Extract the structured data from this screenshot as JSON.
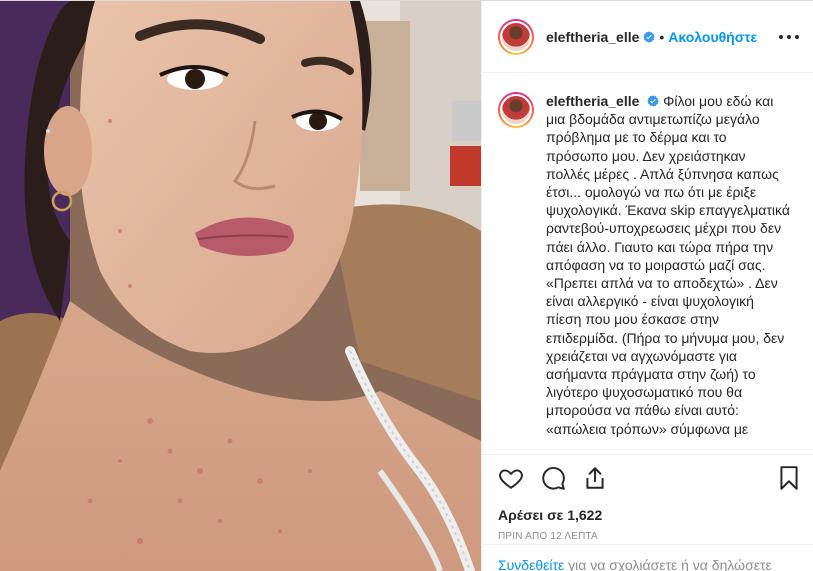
{
  "header": {
    "username": "eleftheria_elle",
    "separator": "•",
    "follow_label": "Ακολουθήστε"
  },
  "caption": {
    "username": "eleftheria_elle",
    "text": "Φίλοι μου εδώ και μια βδομάδα αντιμετωπίζω μεγάλο πρόβλημα με το δέρμα και το πρόσωπο μου. Δεν χρειάστηκαν πολλές μέρες . Απλά ξύπνησα καπως έτσι... ομολογώ να πω ότι με έριξε ψυχολογικά. Έκανα skip επαγγελματικά ραντεβού-υποχρεωσεις μέχρι που δεν πάει άλλο. Γιαυτο και τώρα πήρα την απόφαση να το μοιραστώ μαζί σας. «Πρεπει απλά να το αποδεχτώ» . Δεν είναι αλλεργικό - είναι ψυχολογική πίεση που μου έσκασε στην επιδερμίδα. (Πήρα το μήνυμα μου, δεν χρειάζεται να αγχωνόμαστε για ασήμαντα πράγματα στην ζωή) το λιγότερο ψυχοσωματικό που θα μπορούσα να πάθω είναι αυτό: «απώλεια τρόπων» σύμφωνα με"
  },
  "actions": {
    "like_icon": "heart-icon",
    "comment_icon": "comment-icon",
    "share_icon": "share-icon",
    "save_icon": "bookmark-icon"
  },
  "likes_text": "Αρέσει σε 1,622",
  "timestamp": "ΠΡΙΝ ΑΠΟ 12 ΛΕΠΤΑ",
  "login_bar": {
    "link": "Συνδεθείτε",
    "rest": " για να σχολιάσετε ή να δηλώσετε"
  },
  "colors": {
    "accent": "#0095f6",
    "verified": "#3897f0",
    "text": "#262626",
    "muted": "#8e8e8e"
  }
}
